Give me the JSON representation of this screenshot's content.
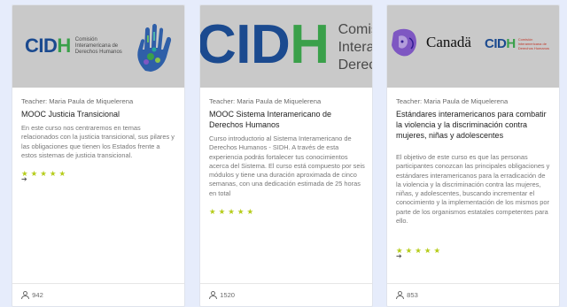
{
  "cards": [
    {
      "banner": {
        "logo_text_main": "CIDH",
        "logo_text_h": "H",
        "logo_sub": "Comisión\nInteramericana de\nDerechos Humanos",
        "logo_sub_1": "Comisión",
        "logo_sub_2": "Interamericana de",
        "logo_sub_3": "Derechos Humanos",
        "icon": "hand-print-icon"
      },
      "teacher": "Teacher: Maria Paula de Miquelerena",
      "title": "MOOC Justicia Transicional",
      "description": "En este curso nos centraremos en temas relacionados con la justicia transicional, sus pilares y las obligaciones que tienen los Estados frente a estos sistemas de justicia transicional.",
      "rating_stars": 5,
      "enroll_icon": "sign-in-icon",
      "students": "942"
    },
    {
      "banner": {
        "logo_text_main": "CIDH",
        "logo_sub_1": "Comisión",
        "logo_sub_2": "Interamericana",
        "logo_sub_3": "Derechos Hu"
      },
      "teacher": "Teacher: Maria Paula de Miquelerena",
      "title": "MOOC Sistema Interamericano de Derechos Humanos",
      "description": "Curso introductorio al Sistema Interamericano de Derechos Humanos - SIDH. A través de esta experiencia podrás fortalecer tus conocimientos acerca del Sistema. El curso está compuesto por seis módulos y tiene una duración aproximada de cinco semanas, con una dedicación estimada de 25 horas en total",
      "rating_stars": 5,
      "students": "1520"
    },
    {
      "banner": {
        "canada": "Canadä",
        "logo_text_main": "CIDH",
        "logo_sub_1": "Comisión",
        "logo_sub_2": "Interamericana de",
        "logo_sub_3": "Derechos Humanos",
        "icon": "faces-illustration-icon"
      },
      "teacher": "Teacher: Maria Paula de Miquelerena",
      "title": "Estándares interamericanos para combatir la violencia y la discriminación contra mujeres, niñas y adolescentes",
      "description": "El objetivo de este curso es que las personas participantes conozcan las principales obligaciones y estándares interamericanos para la erradicación de la violencia y la discriminación contra las mujeres, niñas, y adolescentes, buscando incrementar el conocimiento y la implementación de los mismos por parte de los organismos estatales competentes para ello.",
      "rating_stars": 5,
      "enroll_icon": "sign-in-icon",
      "students": "853"
    }
  ],
  "colors": {
    "page_bg": "#e6ecfb",
    "star": "#b5cc19",
    "cidh_blue": "#1b4a8f",
    "cidh_green": "#3aa04a",
    "banner_bg": "#c9c9c9"
  }
}
